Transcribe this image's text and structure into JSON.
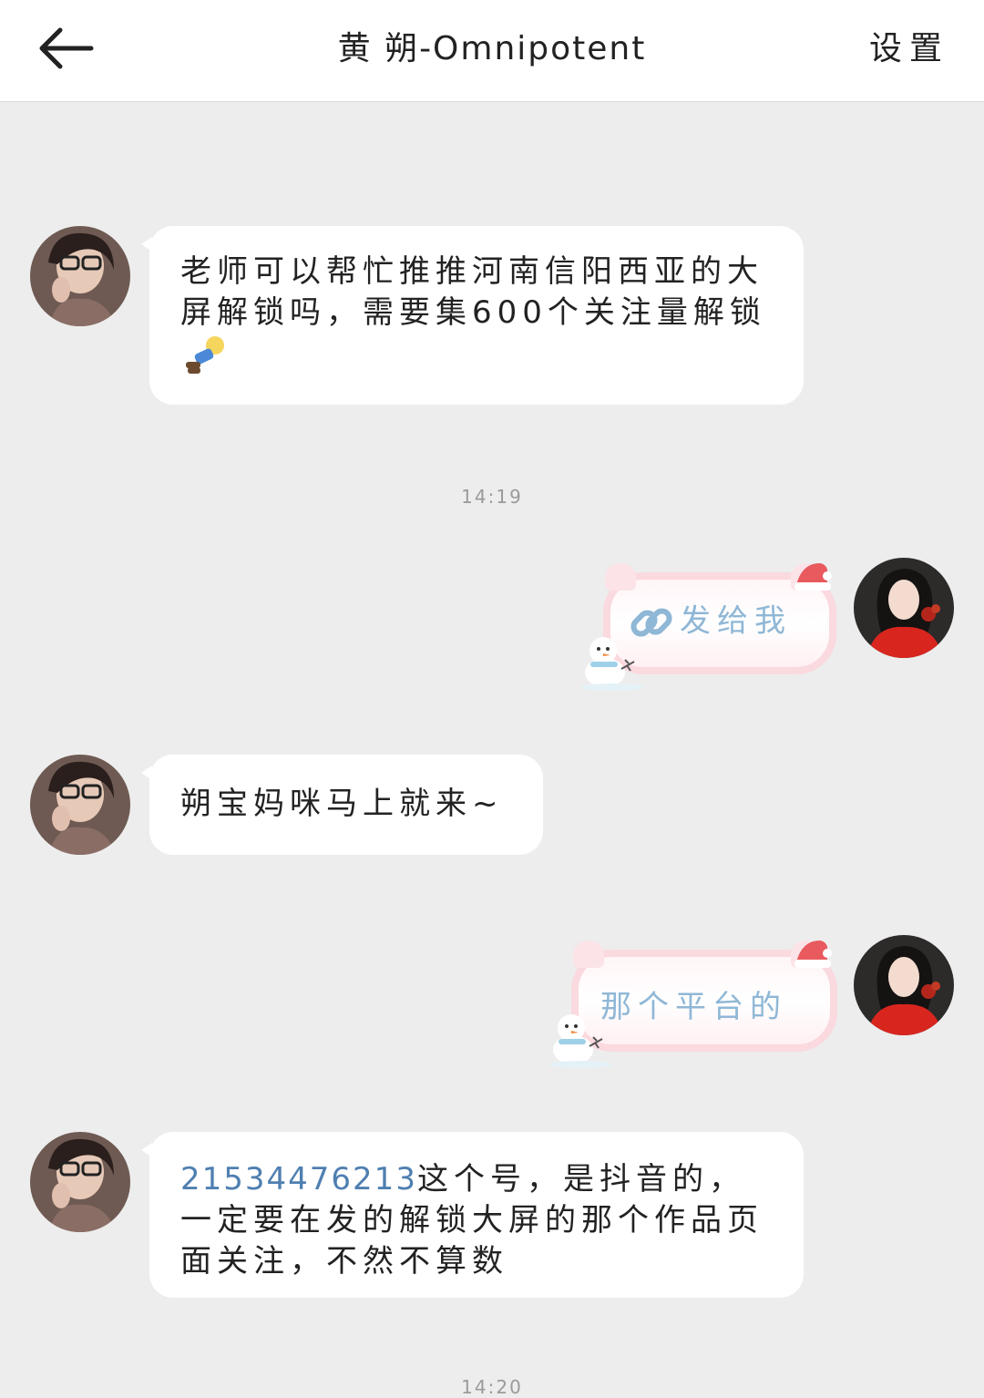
{
  "header": {
    "back_label": "back",
    "title": "黄 朔-Omnipotent",
    "settings_label": "设置"
  },
  "messages": [
    {
      "side": "left",
      "text": "老师可以帮忙推推河南信阳西亚的大屏解锁吗，需要集600个关注量解锁",
      "emoji": "person-lying-emoji"
    },
    {
      "side": "right",
      "text": "发给我",
      "icon": "link-icon",
      "style": "snowman-sticker-bubble"
    },
    {
      "side": "left",
      "text": "朔宝妈咪马上就来~"
    },
    {
      "side": "right",
      "text": "那个平台的",
      "style": "snowman-sticker-bubble"
    },
    {
      "side": "left",
      "number": "2153447621​3",
      "text": "这个号，是抖音的，一定要在发的解锁大屏的那个作品页面关注，不然不算数"
    }
  ],
  "timestamps": [
    "14:19",
    "14:20"
  ],
  "colors": {
    "background": "#ededed",
    "bubble": "#ffffff",
    "link_number": "#4f7fb1",
    "sticker_text": "#8fb7d6",
    "sticker_border": "#fad9df"
  }
}
